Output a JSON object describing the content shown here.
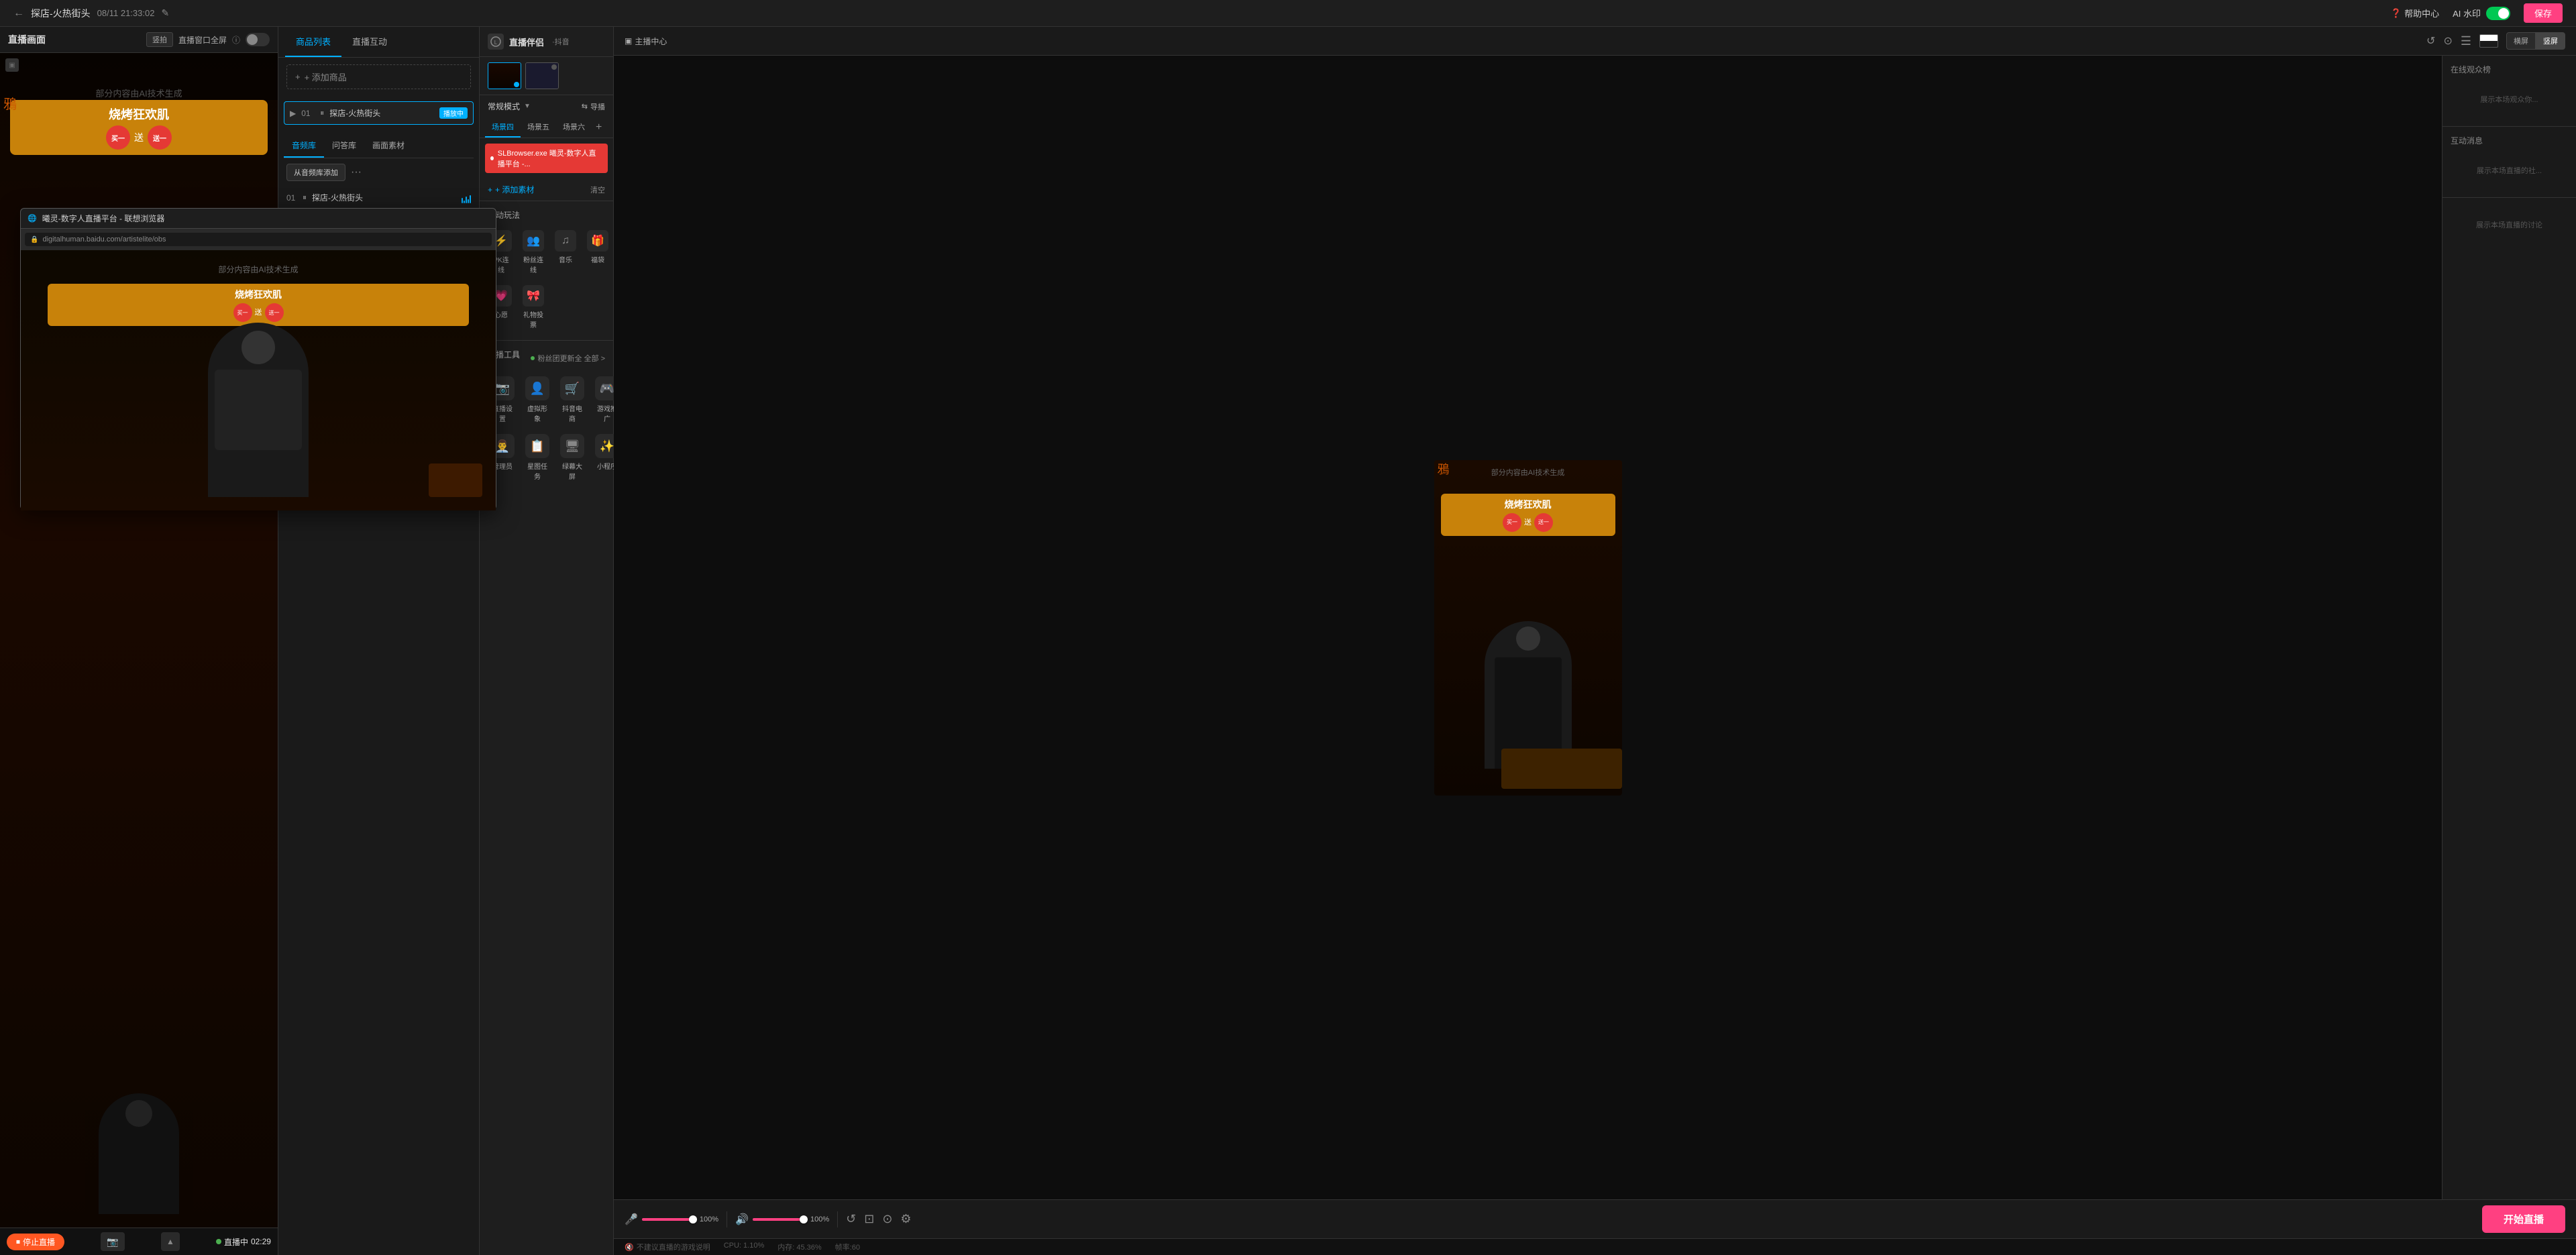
{
  "topbar": {
    "back_label": "←",
    "title": "探店-火热街头",
    "timestamp": "08/11 21:33:02",
    "edit_icon": "✎",
    "help_center": "帮助中心",
    "ai_watermark": "AI 水印",
    "save_label": "保存"
  },
  "left_panel": {
    "title": "直播画面",
    "ratio": "竖拍",
    "fullscreen": "直播窗口全屏",
    "ai_text": "部分内容由AI技术生成",
    "bbq_text": "烧烤狂欢肌",
    "buy_text": "买一送一",
    "stop_live": "停止直播",
    "live_status": "直播中",
    "live_time": "02:29"
  },
  "browser_popup": {
    "title": "曦灵-数字人直播平台 - 联想浏览器",
    "url": "digitalhuman.baidu.com/artistelite/obs"
  },
  "middle_panel": {
    "tab_products": "商品列表",
    "tab_interact": "直播互动",
    "add_product": "+ 添加商品",
    "scene_items": [
      {
        "num": "01",
        "name": "探店-火热街头",
        "badge": "播放中",
        "badge_type": "blue"
      }
    ],
    "audio_tabs": [
      "音频库",
      "问答库",
      "画面素材"
    ],
    "audio_library_btn": "从音频库添加",
    "more": "···",
    "audio_items": [
      {
        "num": "01",
        "name": "探店-火热街头"
      }
    ]
  },
  "companion_panel": {
    "title": "直播伴侣",
    "platform": "·抖音",
    "mode": "常规模式",
    "import": "导播",
    "scene_tabs": [
      "场景四",
      "场景五",
      "场景六"
    ],
    "add_scene": "+",
    "app_overlay": "SLBrowser.exe 曦灵-数字人直播平台 -...",
    "add_material": "+ 添加素材",
    "clear": "清空",
    "interaction_title": "互动玩法",
    "methods": [
      {
        "icon": "⚡",
        "label": "PK连线"
      },
      {
        "icon": "👥",
        "label": "粉丝连线"
      },
      {
        "icon": "♫",
        "label": "音乐"
      },
      {
        "icon": "🎁",
        "label": "福袋"
      },
      {
        "icon": "💗",
        "label": "心愿"
      },
      {
        "icon": "🎀",
        "label": "礼物投票"
      }
    ],
    "tools_title": "直播工具",
    "fans_update": "粉丝团更新全 全部 >",
    "tools": [
      {
        "icon": "📷",
        "label": "直播设置"
      },
      {
        "icon": "👤",
        "label": "虚拟形象"
      },
      {
        "icon": "🛒",
        "label": "抖音电商"
      },
      {
        "icon": "🎮",
        "label": "游戏推广"
      },
      {
        "icon": "👨‍💼",
        "label": "管理员"
      },
      {
        "icon": "📋",
        "label": "星图任务"
      },
      {
        "icon": "🖥",
        "label": "绿幕大屏"
      },
      {
        "icon": "✨",
        "label": "小程序"
      }
    ]
  },
  "right_panel": {
    "host_center": "主播中心",
    "ai_text": "部分内容由AI技术生成",
    "bbq_text": "烧烤狂欢肌",
    "buy_text": "买一送一",
    "view_horizontal": "横屏",
    "view_vertical": "竖屏",
    "online_audience": "在线观众榜",
    "audience_note": "展示本场观众你...",
    "interaction_title": "互动消息",
    "interaction_note": "展示本场直播的社...",
    "discuss_title": "展示本场直播的讨论",
    "mic_pct": "100%",
    "speaker_pct": "100%",
    "start_live": "开始直播",
    "status": {
      "cpu": "CPU: 1.10%",
      "memory": "内存: 45.36%",
      "framerate": "帧率:60"
    },
    "game_warning": "不建议直播的游戏说明"
  }
}
